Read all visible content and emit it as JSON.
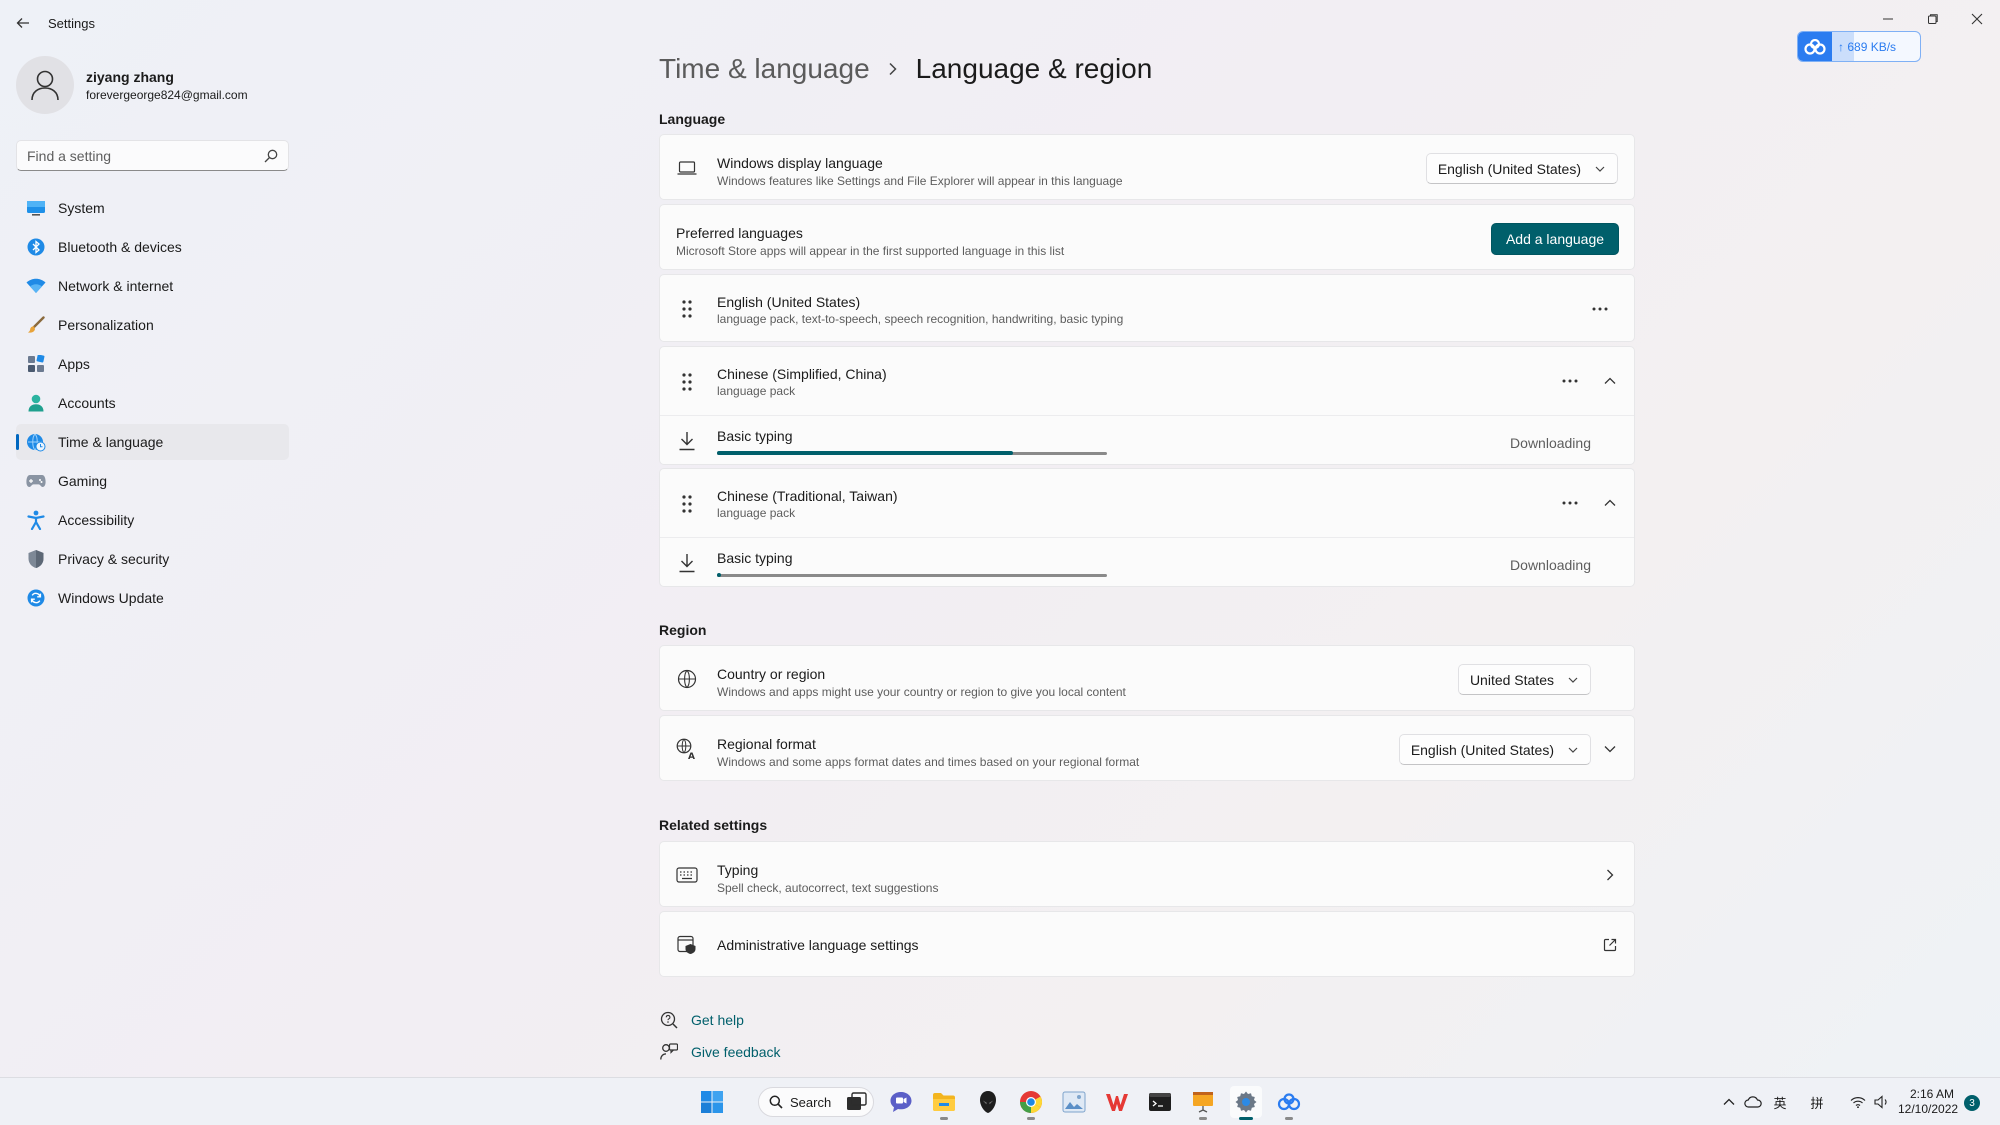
{
  "app": {
    "title": "Settings"
  },
  "speed_widget": {
    "text": "689 KB/s"
  },
  "profile": {
    "name": "ziyang zhang",
    "email": "forevergeorge824@gmail.com"
  },
  "search": {
    "placeholder": "Find a setting"
  },
  "nav": {
    "items": [
      {
        "label": "System",
        "icon": "system-icon"
      },
      {
        "label": "Bluetooth & devices",
        "icon": "bluetooth-icon"
      },
      {
        "label": "Network & internet",
        "icon": "wifi-icon"
      },
      {
        "label": "Personalization",
        "icon": "brush-icon"
      },
      {
        "label": "Apps",
        "icon": "apps-icon"
      },
      {
        "label": "Accounts",
        "icon": "person-icon"
      },
      {
        "label": "Time & language",
        "icon": "globe-clock-icon",
        "active": true
      },
      {
        "label": "Gaming",
        "icon": "gamepad-icon"
      },
      {
        "label": "Accessibility",
        "icon": "accessibility-icon"
      },
      {
        "label": "Privacy & security",
        "icon": "shield-icon"
      },
      {
        "label": "Windows Update",
        "icon": "update-icon"
      }
    ]
  },
  "breadcrumb": {
    "parent": "Time & language",
    "current": "Language & region"
  },
  "language": {
    "section_title": "Language",
    "display_language": {
      "title": "Windows display language",
      "desc": "Windows features like Settings and File Explorer will appear in this language",
      "value": "English (United States)"
    },
    "preferred": {
      "title": "Preferred languages",
      "desc": "Microsoft Store apps will appear in the first supported language in this list",
      "button": "Add a language"
    },
    "languages": [
      {
        "title": "English (United States)",
        "desc": "language pack, text-to-speech, speech recognition, handwriting, basic typing"
      },
      {
        "title": "Chinese (Simplified, China)",
        "desc": "language pack",
        "sub": {
          "title": "Basic typing",
          "status": "Downloading",
          "progress": 0.76
        }
      },
      {
        "title": "Chinese (Traditional, Taiwan)",
        "desc": "language pack",
        "sub": {
          "title": "Basic typing",
          "status": "Downloading",
          "progress": 0.01
        }
      }
    ]
  },
  "region": {
    "section_title": "Region",
    "country": {
      "title": "Country or region",
      "desc": "Windows and apps might use your country or region to give you local content",
      "value": "United States"
    },
    "format": {
      "title": "Regional format",
      "desc": "Windows and some apps format dates and times based on your regional format",
      "value": "English (United States)"
    }
  },
  "related": {
    "section_title": "Related settings",
    "typing": {
      "title": "Typing",
      "desc": "Spell check, autocorrect, text suggestions"
    },
    "admin": {
      "title": "Administrative language settings"
    }
  },
  "help": {
    "get_help": "Get help",
    "give_feedback": "Give feedback"
  },
  "taskbar": {
    "search_label": "Search",
    "ime_1": "英",
    "ime_2": "拼",
    "time": "2:16 AM",
    "date": "12/10/2022",
    "notifications": "3"
  },
  "colors": {
    "accent": "#005f6b",
    "link": "#005f6b",
    "nav_indicator": "#0067c0"
  }
}
